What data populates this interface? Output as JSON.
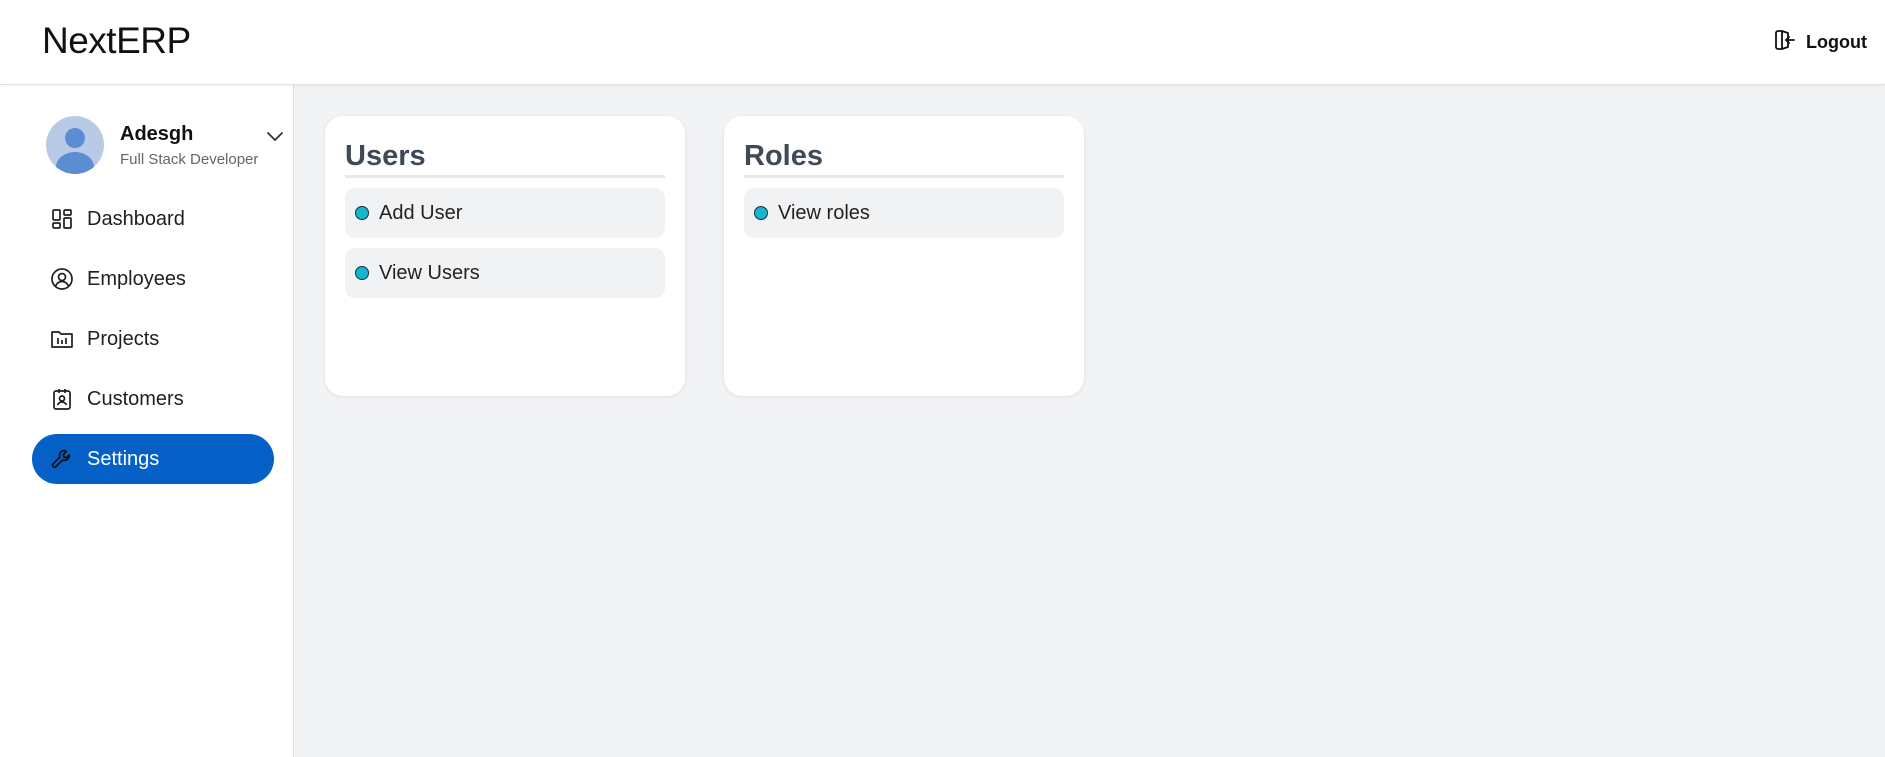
{
  "header": {
    "brand": "NextERP",
    "logout_label": "Logout"
  },
  "profile": {
    "name": "Adesgh",
    "role": "Full Stack Developer"
  },
  "sidebar": {
    "items": [
      {
        "label": "Dashboard",
        "icon": "dashboard-icon"
      },
      {
        "label": "Employees",
        "icon": "user-circle-icon"
      },
      {
        "label": "Projects",
        "icon": "folder-chart-icon"
      },
      {
        "label": "Customers",
        "icon": "contact-badge-icon"
      },
      {
        "label": "Settings",
        "icon": "wrench-icon",
        "active": true
      }
    ]
  },
  "cards": [
    {
      "title": "Users",
      "items": [
        "Add User",
        "View Users"
      ]
    },
    {
      "title": "Roles",
      "items": [
        "View roles"
      ]
    }
  ],
  "colors": {
    "accent": "#0561c7",
    "dot": "#17b4d0",
    "background": "#f2f3f5",
    "card_title": "#3f4a58"
  }
}
